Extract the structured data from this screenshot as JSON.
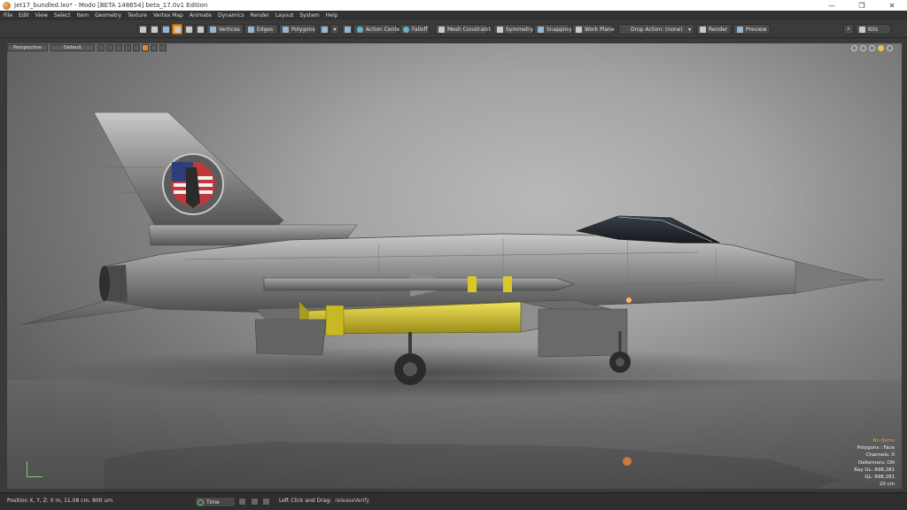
{
  "window": {
    "title": "Jet17_bundled.lxo* - Modo [BETA 148654]  beta_17.0v1 Edition",
    "controls": {
      "minimize": "—",
      "restore": "❐",
      "close": "✕"
    }
  },
  "menu": [
    "File",
    "Edit",
    "View",
    "Select",
    "Item",
    "Geometry",
    "Texture",
    "Vertex Map",
    "Animate",
    "Dynamics",
    "Render",
    "Layout",
    "System",
    "Help"
  ],
  "toolbar": {
    "vertices": "Vertices",
    "edges": "Edges",
    "polygons": "Polygons",
    "action_center": "Action Center",
    "falloff": "Falloff",
    "mesh_constraint": "Mesh Constraint",
    "symmetry": "Symmetry",
    "snapping": "Snapping",
    "work_plane": "Work Plane",
    "drop_action": "Drop Action: (none)",
    "render": "Render",
    "preview": "Preview",
    "kits": "Kits"
  },
  "viewport": {
    "view_label": "Perspective",
    "shading": "Default",
    "stats": {
      "items": "No Items",
      "polygons": "Polygons : Face",
      "channels": "Channels: 0",
      "deformers": "Deformers: ON",
      "ray_gl": "Ray GL: 898,281",
      "gl": "GL: 898,281",
      "scale": "20 cm"
    }
  },
  "status": {
    "position": "Position X, Y, Z:  0 m, 11.08 cm, 800 um",
    "time_label": "Time",
    "hint_label": "Left Click and Drag:",
    "hint_value": "releaseVerify"
  },
  "colors": {
    "accent": "#e88a1a",
    "stats_highlight": "#f0a030",
    "ordnance_yellow": "#d8c82a"
  }
}
